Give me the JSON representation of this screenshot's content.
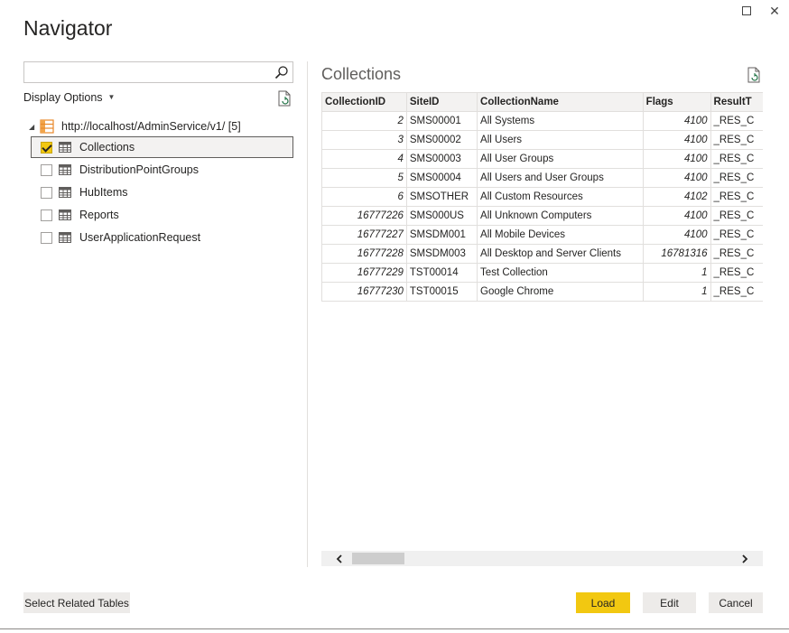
{
  "window": {
    "maximize_glyph": "",
    "close_glyph": "✕"
  },
  "title": "Navigator",
  "search": {
    "value": "",
    "placeholder": ""
  },
  "display_options": {
    "label": "Display Options"
  },
  "tree": {
    "root_label": "http://localhost/AdminService/v1/ [5]",
    "items": [
      {
        "label": "Collections",
        "checked": true,
        "selected": true
      },
      {
        "label": "DistributionPointGroups",
        "checked": false,
        "selected": false
      },
      {
        "label": "HubItems",
        "checked": false,
        "selected": false
      },
      {
        "label": "Reports",
        "checked": false,
        "selected": false
      },
      {
        "label": "UserApplicationRequest",
        "checked": false,
        "selected": false
      }
    ]
  },
  "preview": {
    "title": "Collections",
    "columns": [
      "CollectionID",
      "SiteID",
      "CollectionName",
      "Flags",
      "ResultT"
    ],
    "rows": [
      [
        "2",
        "SMS00001",
        "All Systems",
        "4100",
        "_RES_C"
      ],
      [
        "3",
        "SMS00002",
        "All Users",
        "4100",
        "_RES_C"
      ],
      [
        "4",
        "SMS00003",
        "All User Groups",
        "4100",
        "_RES_C"
      ],
      [
        "5",
        "SMS00004",
        "All Users and User Groups",
        "4100",
        "_RES_C"
      ],
      [
        "6",
        "SMSOTHER",
        "All Custom Resources",
        "4102",
        "_RES_C"
      ],
      [
        "16777226",
        "SMS000US",
        "All Unknown Computers",
        "4100",
        "_RES_C"
      ],
      [
        "16777227",
        "SMSDM001",
        "All Mobile Devices",
        "4100",
        "_RES_C"
      ],
      [
        "16777228",
        "SMSDM003",
        "All Desktop and Server Clients",
        "16781316",
        "_RES_C"
      ],
      [
        "16777229",
        "TST00014",
        "Test Collection",
        "1",
        "_RES_C"
      ],
      [
        "16777230",
        "TST00015",
        "Google Chrome",
        "1",
        "_RES_C"
      ]
    ]
  },
  "buttons": {
    "select_related": "Select Related Tables",
    "load": "Load",
    "edit": "Edit",
    "cancel": "Cancel"
  },
  "colors": {
    "accent": "#f2c811",
    "button_bg": "#edebe9",
    "header_bg": "#f3f2f1"
  },
  "icons": [
    "search-icon",
    "refresh-icon",
    "server-icon",
    "table-icon",
    "chevron-left-icon",
    "chevron-right-icon",
    "maximize-icon",
    "close-icon"
  ]
}
